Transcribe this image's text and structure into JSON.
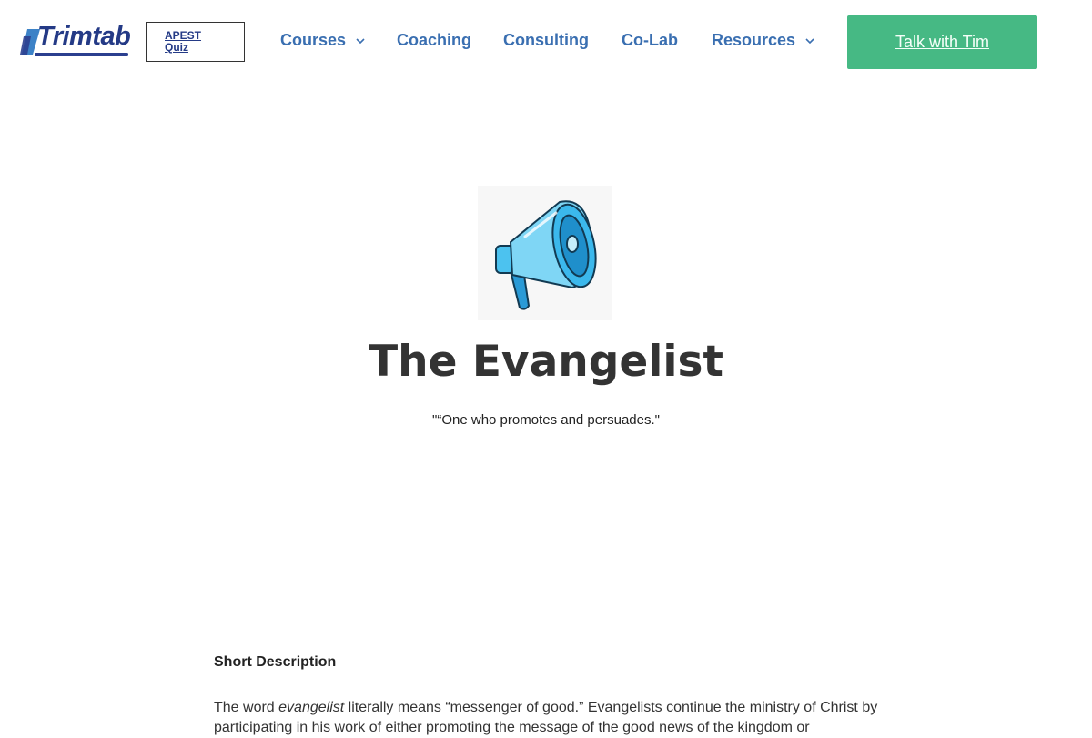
{
  "header": {
    "logo_text": "Trimtab",
    "quiz_button": "APEST Quiz",
    "nav": [
      {
        "label": "Courses",
        "has_dropdown": true
      },
      {
        "label": "Coaching",
        "has_dropdown": false
      },
      {
        "label": "Consulting",
        "has_dropdown": false
      },
      {
        "label": "Co-Lab",
        "has_dropdown": false
      },
      {
        "label": "Resources",
        "has_dropdown": true
      }
    ],
    "cta_label": "Talk with Tim"
  },
  "hero": {
    "icon": "megaphone-icon",
    "title": "The Evangelist",
    "tagline": "\"“One who promotes and persuades.\""
  },
  "content": {
    "section_title": "Short Description",
    "intro_prefix": "The word ",
    "intro_emphasis": "evangelist",
    "intro_rest": " literally means “messenger of good.” Evangelists continue the ministry of Christ by participating in his work of either promoting the message of the good news of the kingdom or"
  },
  "colors": {
    "nav_text": "#3a6fb1",
    "cta_bg": "#46b984",
    "logo": "#243a86",
    "title": "#333333",
    "tagline_dash": "#3a8fd0"
  }
}
